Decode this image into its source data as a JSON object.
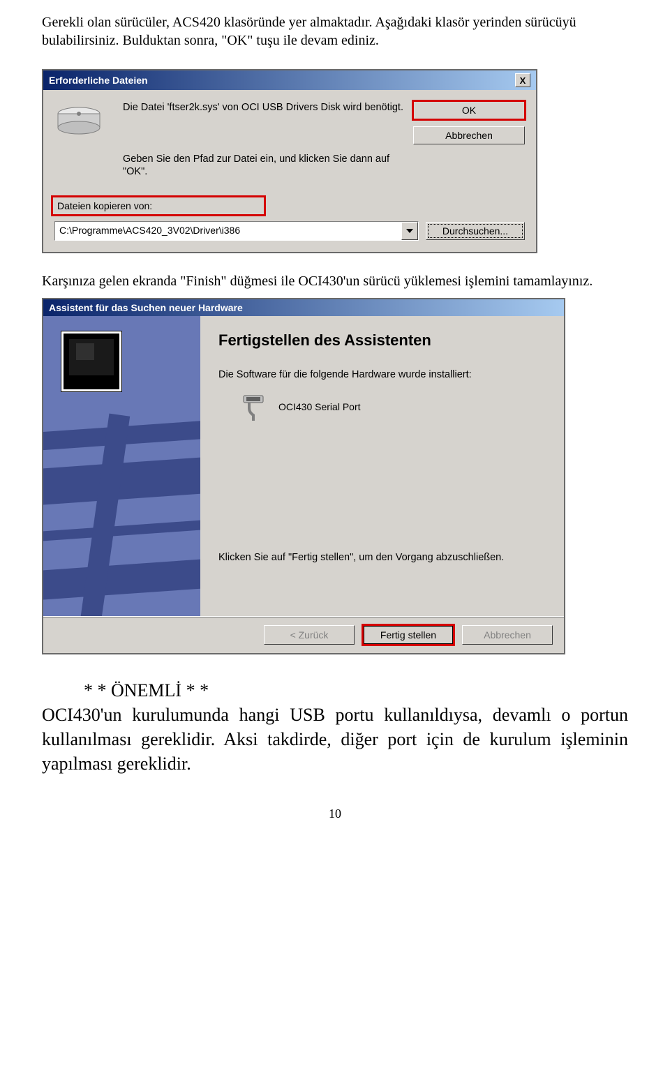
{
  "intro": "Gerekli olan sürücüler, ACS420 klasöründe yer almaktadır. Aşağıdaki klasör yerinden sürücüyü bulabilirsiniz. Bulduktan sonra, \"OK\" tuşu ile devam ediniz.",
  "dlg1": {
    "title": "Erforderliche Dateien",
    "close": "X",
    "msg1": "Die Datei 'ftser2k.sys' von OCI USB Drivers Disk wird benötigt.",
    "msg2": "Geben Sie den Pfad zur Datei ein, und klicken Sie dann auf \"OK\".",
    "ok": "OK",
    "cancel": "Abbrechen",
    "path_label": "Dateien kopieren von:",
    "path_value": "C:\\Programme\\ACS420_3V02\\Driver\\i386",
    "browse": "Durchsuchen..."
  },
  "mid": "Karşınıza gelen ekranda \"Finish\" düğmesi ile OCI430'un sürücü yüklemesi işlemini tamamlayınız.",
  "dlg2": {
    "title": "Assistent für das Suchen neuer Hardware",
    "heading": "Fertigstellen des Assistenten",
    "line1": "Die Software für die folgende Hardware wurde installiert:",
    "hw_name": "OCI430 Serial Port",
    "foot_text": "Klicken Sie auf \"Fertig stellen\", um den Vorgang abzuschließen.",
    "back": "< Zurück",
    "finish": "Fertig stellen",
    "cancel": "Abbrechen"
  },
  "note": {
    "title": "* * ÖNEMLİ * *",
    "body": "OCI430'un kurulumunda hangi USB portu kullanıldıysa, devamlı o portun kullanılması gereklidir. Aksi takdirde, diğer port için de kurulum işleminin yapılması gereklidir."
  },
  "page_num": "10"
}
